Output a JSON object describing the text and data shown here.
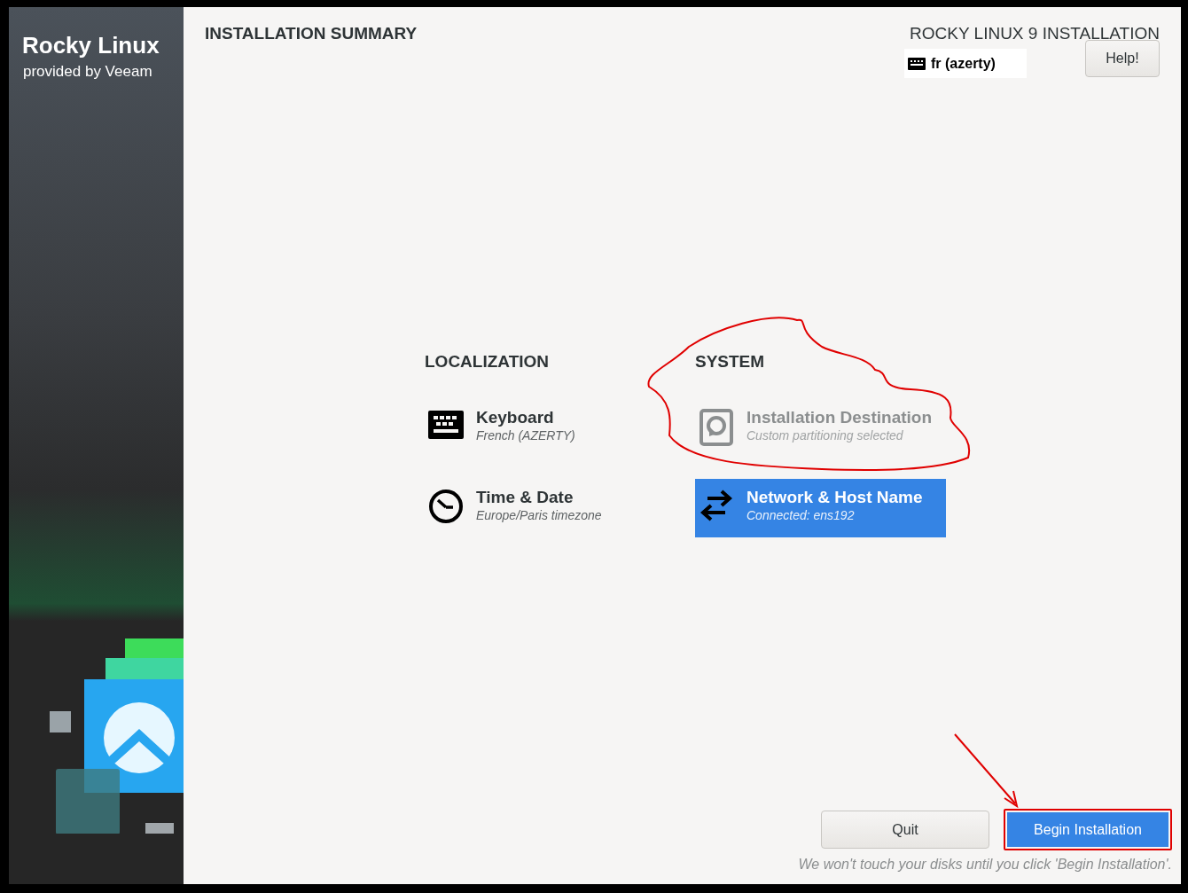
{
  "sidebar": {
    "brand": "Rocky Linux",
    "subtitle": "provided by Veeam"
  },
  "header": {
    "title": "INSTALLATION SUMMARY",
    "product": "ROCKY LINUX 9 INSTALLATION",
    "keyboard_layout": "fr (azerty)",
    "help_button": "Help!"
  },
  "categories": [
    {
      "title": "LOCALIZATION",
      "spokes": [
        {
          "title": "Keyboard",
          "status": "French (AZERTY)",
          "selected": false,
          "disabled": false
        },
        {
          "title": "Time & Date",
          "status": "Europe/Paris timezone",
          "selected": false,
          "disabled": false
        }
      ]
    },
    {
      "title": "SYSTEM",
      "spokes": [
        {
          "title": "Installation Destination",
          "status": "Custom partitioning selected",
          "selected": false,
          "disabled": true
        },
        {
          "title": "Network & Host Name",
          "status": "Connected: ens192",
          "selected": true,
          "disabled": false
        }
      ]
    }
  ],
  "buttons": [
    {
      "label": "Quit",
      "kind": "secondary"
    },
    {
      "label": "Begin Installation",
      "kind": "primary"
    }
  ],
  "note": "We won't touch your disks until you click 'Begin Installation'."
}
